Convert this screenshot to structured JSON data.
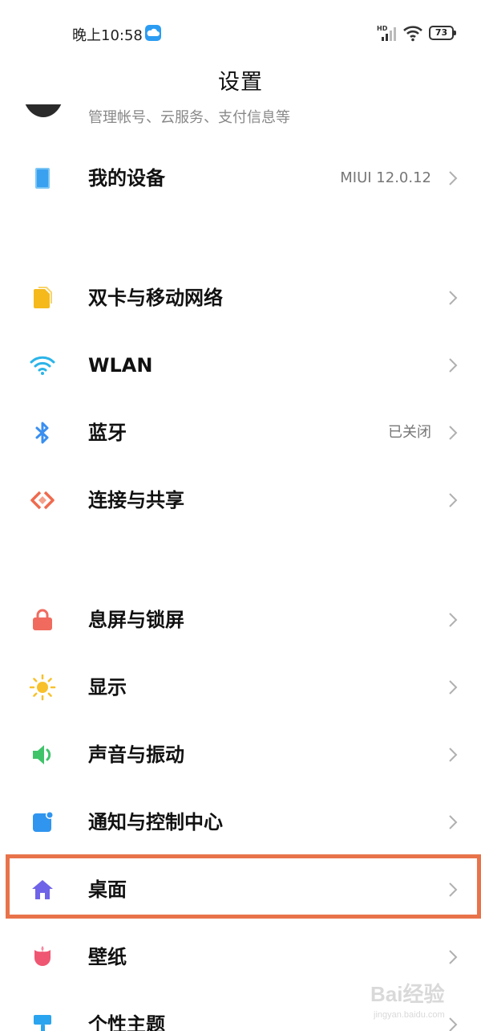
{
  "status_bar": {
    "time": "晚上10:58",
    "battery": "73",
    "network": "HD"
  },
  "header": {
    "title": "设置"
  },
  "account": {
    "subtitle": "管理帐号、云服务、支付信息等"
  },
  "settings": {
    "my_device": {
      "label": "我的设备",
      "value": "MIUI 12.0.12",
      "icon": "tablet-icon"
    },
    "sim": {
      "label": "双卡与移动网络",
      "icon": "sim-card-icon"
    },
    "wlan": {
      "label": "WLAN",
      "icon": "wifi-icon"
    },
    "bluetooth": {
      "label": "蓝牙",
      "value": "已关闭",
      "icon": "bluetooth-icon"
    },
    "connection": {
      "label": "连接与共享",
      "icon": "connection-share-icon"
    },
    "lockscreen": {
      "label": "息屏与锁屏",
      "icon": "lock-icon"
    },
    "display": {
      "label": "显示",
      "icon": "sun-icon"
    },
    "sound": {
      "label": "声音与振动",
      "icon": "speaker-icon"
    },
    "notifications": {
      "label": "通知与控制中心",
      "icon": "notification-icon"
    },
    "home": {
      "label": "桌面",
      "icon": "home-icon"
    },
    "wallpaper": {
      "label": "壁纸",
      "icon": "tulip-icon"
    },
    "theme": {
      "label": "个性主题",
      "icon": "brush-icon"
    }
  },
  "watermark": {
    "logo": "Bai经验",
    "url": "jingyan.baidu.com"
  },
  "colors": {
    "highlight": "#e8734a",
    "device_blue": "#3aa0f0",
    "sim_yellow": "#f5b91c",
    "wifi_blue": "#2bb4e8",
    "bluetooth_blue": "#3a8ff0",
    "connection_orange": "#ef6a4e",
    "lock_red": "#f06b5e",
    "sun_yellow": "#f8c12c",
    "speaker_green": "#3fc46a",
    "notification_blue": "#2f95ef",
    "home_purple": "#6f63e8",
    "wallpaper_pink": "#ef5672",
    "theme_blue": "#2aa4ee"
  }
}
